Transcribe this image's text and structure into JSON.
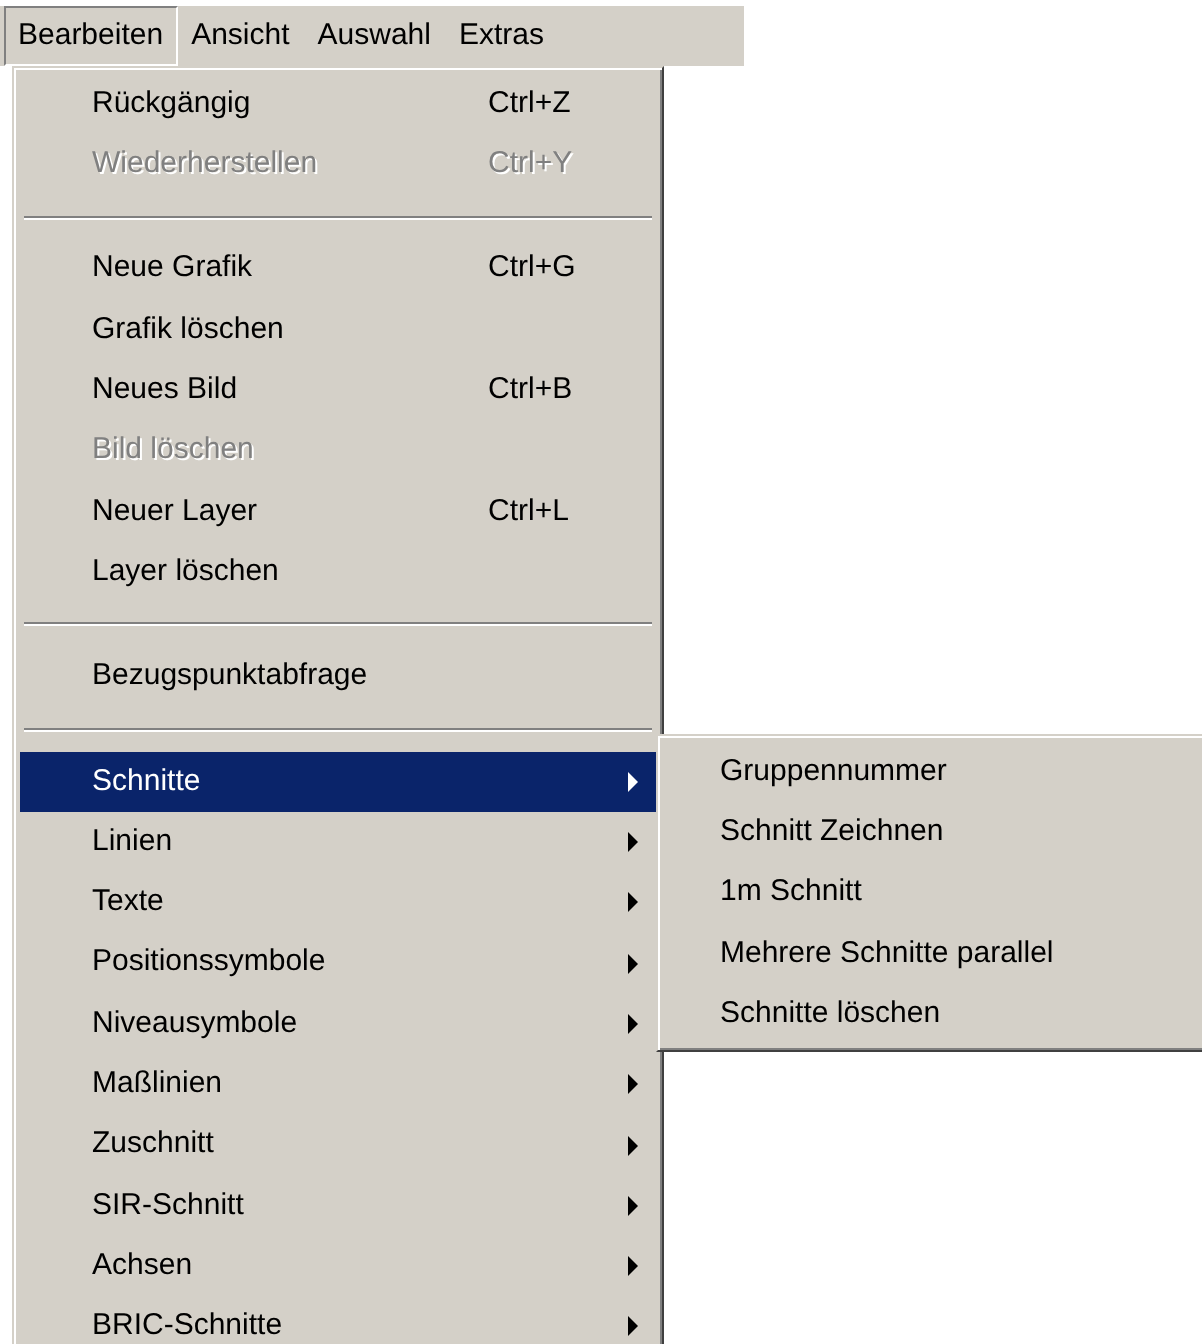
{
  "menubar": [
    {
      "label": "Bearbeiten",
      "selected": true
    },
    {
      "label": "Ansicht",
      "selected": false
    },
    {
      "label": "Auswahl",
      "selected": false
    },
    {
      "label": "Extras",
      "selected": false
    }
  ],
  "menu": {
    "items": [
      {
        "kind": "item",
        "label": "Rückgängig",
        "shortcut": "Ctrl+Z",
        "disabled": false,
        "submenu": false,
        "selected": false
      },
      {
        "kind": "item",
        "label": "Wiederherstellen",
        "shortcut": "Ctrl+Y",
        "disabled": true,
        "submenu": false,
        "selected": false
      },
      {
        "kind": "separator"
      },
      {
        "kind": "item",
        "label": "Neue Grafik",
        "shortcut": "Ctrl+G",
        "disabled": false,
        "submenu": false,
        "selected": false
      },
      {
        "kind": "item",
        "label": "Grafik löschen",
        "disabled": false,
        "submenu": false,
        "selected": false
      },
      {
        "kind": "item",
        "label": "Neues Bild",
        "shortcut": "Ctrl+B",
        "disabled": false,
        "submenu": false,
        "selected": false
      },
      {
        "kind": "item",
        "label": "Bild löschen",
        "disabled": true,
        "submenu": false,
        "selected": false
      },
      {
        "kind": "item",
        "label": "Neuer Layer",
        "shortcut": "Ctrl+L",
        "disabled": false,
        "submenu": false,
        "selected": false
      },
      {
        "kind": "item",
        "label": "Layer löschen",
        "disabled": false,
        "submenu": false,
        "selected": false
      },
      {
        "kind": "separator"
      },
      {
        "kind": "item",
        "label": "Bezugspunktabfrage",
        "disabled": false,
        "submenu": false,
        "selected": false
      },
      {
        "kind": "separator"
      },
      {
        "kind": "item",
        "label": "Schnitte",
        "disabled": false,
        "submenu": true,
        "selected": true
      },
      {
        "kind": "item",
        "label": "Linien",
        "disabled": false,
        "submenu": true,
        "selected": false
      },
      {
        "kind": "item",
        "label": "Texte",
        "disabled": false,
        "submenu": true,
        "selected": false
      },
      {
        "kind": "item",
        "label": "Positionssymbole",
        "disabled": false,
        "submenu": true,
        "selected": false
      },
      {
        "kind": "item",
        "label": "Niveausymbole",
        "disabled": false,
        "submenu": true,
        "selected": false
      },
      {
        "kind": "item",
        "label": "Maßlinien",
        "disabled": false,
        "submenu": true,
        "selected": false
      },
      {
        "kind": "item",
        "label": "Zuschnitt",
        "disabled": false,
        "submenu": true,
        "selected": false
      },
      {
        "kind": "item",
        "label": "SIR-Schnitt",
        "disabled": false,
        "submenu": true,
        "selected": false
      },
      {
        "kind": "item",
        "label": "Achsen",
        "disabled": false,
        "submenu": true,
        "selected": false
      },
      {
        "kind": "item",
        "label": "BRIC-Schnitte",
        "disabled": false,
        "submenu": true,
        "selected": false
      }
    ]
  },
  "submenu": {
    "items": [
      {
        "label": "Gruppennummer"
      },
      {
        "label": "Schnitt Zeichnen"
      },
      {
        "label": "1m Schnitt"
      },
      {
        "label": "Mehrere Schnitte parallel"
      },
      {
        "label": "Schnitte löschen"
      }
    ]
  }
}
